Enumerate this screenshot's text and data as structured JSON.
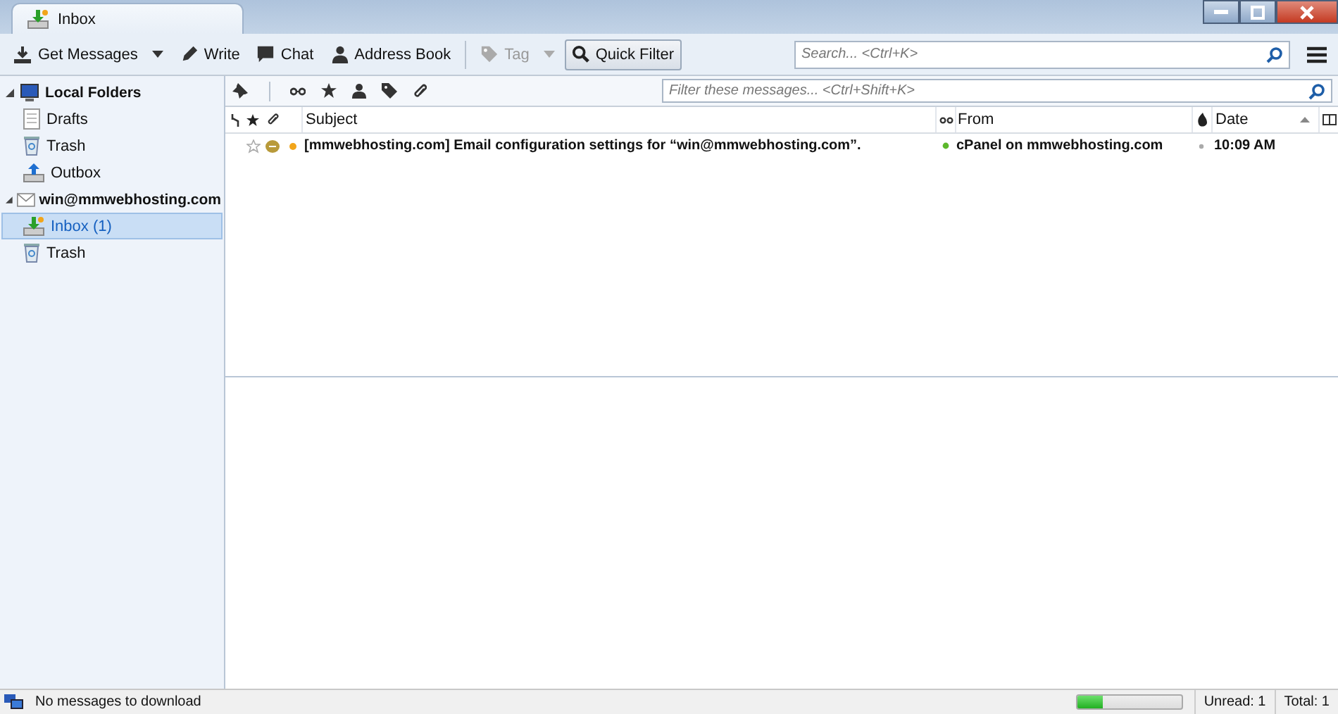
{
  "tab": {
    "title": "Inbox",
    "selected": true
  },
  "toolbar": {
    "buttons": [
      {
        "label": "Get Messages",
        "kind": "download",
        "dropdown": true,
        "disabled": false,
        "on": false
      },
      {
        "label": "Write",
        "kind": "pencil",
        "dropdown": false,
        "disabled": false,
        "on": false
      },
      {
        "label": "Chat",
        "kind": "chat",
        "dropdown": false,
        "disabled": false,
        "on": false
      },
      {
        "label": "Address Book",
        "kind": "person",
        "dropdown": false,
        "disabled": false,
        "on": false
      },
      {
        "label": "Tag",
        "kind": "tag",
        "dropdown": true,
        "disabled": true,
        "on": false
      },
      {
        "label": "Quick Filter",
        "kind": "search",
        "dropdown": false,
        "disabled": false,
        "on": true
      }
    ],
    "search": {
      "placeholder": "Search... <Ctrl+K>"
    }
  },
  "folders": [
    {
      "label": "Local Folders",
      "kind": "computer",
      "expanded": true,
      "selected": false,
      "children": [
        {
          "label": "Drafts",
          "kind": "drafts",
          "selected": false
        },
        {
          "label": "Trash",
          "kind": "trash",
          "selected": false
        },
        {
          "label": "Outbox",
          "kind": "outbox",
          "selected": false
        }
      ]
    },
    {
      "label": "win@mmwebhosting.com",
      "kind": "account",
      "expanded": true,
      "selected": false,
      "children": [
        {
          "label": "Inbox (1)",
          "kind": "inbox",
          "selected": true
        },
        {
          "label": "Trash",
          "kind": "trash",
          "selected": false
        }
      ]
    }
  ],
  "filter_bar": {
    "placeholder": "Filter these messages... <Ctrl+Shift+K>"
  },
  "columns": [
    {
      "label": "Subject"
    },
    {
      "label": "From"
    },
    {
      "label": "Date",
      "sorted": true
    }
  ],
  "messages": [
    {
      "subject": "[mmwebhosting.com] Email configuration settings for “win@mmwebhosting.com”.",
      "from": "cPanel on mmwebhosting.com",
      "date": "10:09 AM",
      "unread": true,
      "starred": false
    }
  ],
  "status_bar": {
    "text": "No messages to download",
    "level": 0.25,
    "unread": "Unread: 1",
    "total": "Total: 1"
  }
}
